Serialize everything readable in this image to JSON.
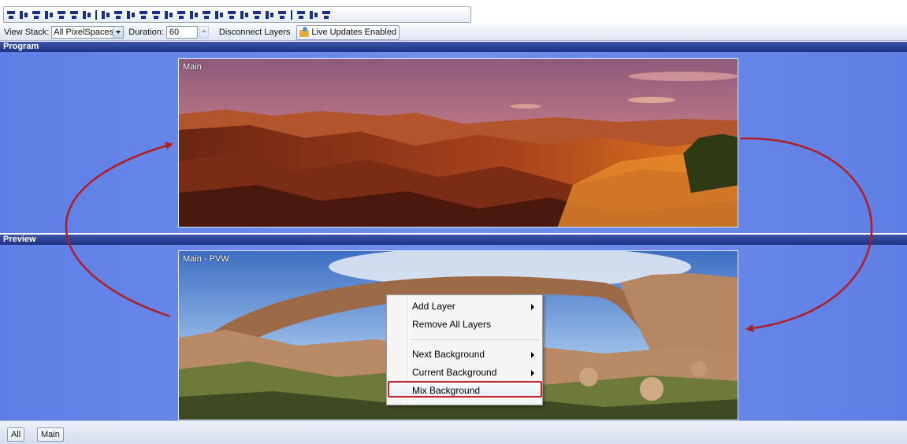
{
  "toolbar_icons": [
    "align-left-icon",
    "align-center-icon",
    "align-right-icon",
    "align-top-icon",
    "align-middle-icon",
    "align-bottom-icon",
    "distribute-h-icon",
    "distribute-v-icon",
    "same-width-icon",
    "same-height-icon",
    "same-size-icon",
    "center-h-icon",
    "center-v-icon",
    "space-h-icon",
    "space-v-icon",
    "grid-icon"
  ],
  "control_bar": {
    "view_stack_label": "View Stack:",
    "view_stack_value": "All PixelSpaces",
    "duration_label": "Duration:",
    "duration_value": "60",
    "disconnect_label": "Disconnect Layers",
    "live_updates_label": "Live Updates Enabled"
  },
  "program": {
    "header": "Program",
    "frame_label": "Main"
  },
  "preview": {
    "header": "Preview",
    "frame_label": "Main - PVW"
  },
  "context_menu": {
    "items": [
      {
        "label": "Add Layer",
        "submenu": true
      },
      {
        "label": "Remove All Layers",
        "submenu": false
      },
      {
        "label": "Next Background",
        "submenu": true
      },
      {
        "label": "Current Background",
        "submenu": true
      },
      {
        "label": "Mix Background",
        "submenu": false,
        "highlighted": true
      }
    ]
  },
  "bottom_tabs": [
    "All",
    "Main"
  ],
  "colors": {
    "header_blue": "#1f3284",
    "body_blue": "#6686e8",
    "annotation_red": "#b01c23"
  }
}
